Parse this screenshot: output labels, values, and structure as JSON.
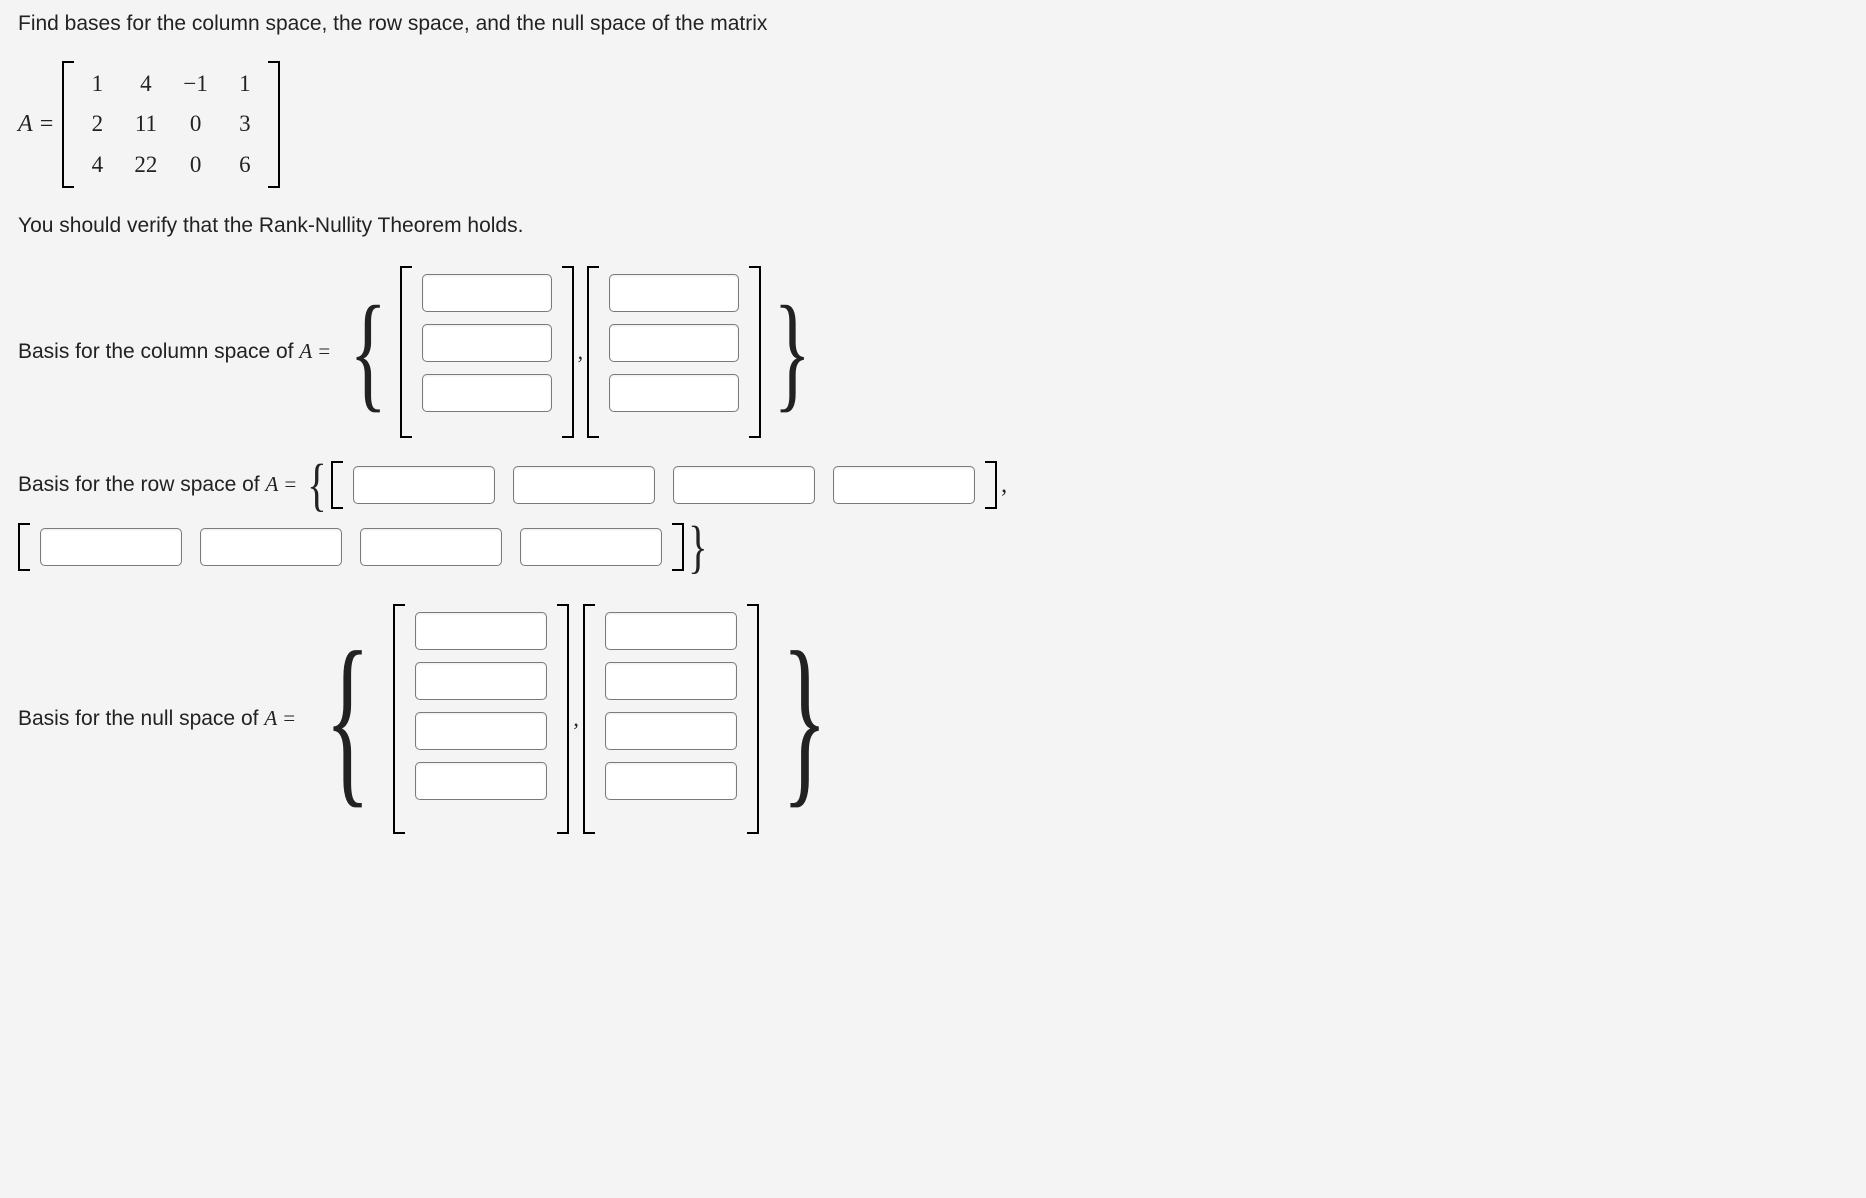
{
  "intro": "Find bases for the column space, the row space, and the null space of the matrix",
  "matrix_prefix": "A = ",
  "matrix": {
    "r1c1": "1",
    "r1c2": "4",
    "r1c3": "−1",
    "r1c4": "1",
    "r2c1": "2",
    "r2c2": "11",
    "r2c3": "0",
    "r2c4": "3",
    "r3c1": "4",
    "r3c2": "22",
    "r3c3": "0",
    "r3c4": "6"
  },
  "verify": "You should verify that the Rank-Nullity Theorem holds.",
  "labels": {
    "colspace": "Basis for the column space of ",
    "rowspace": "Basis for the row space of ",
    "nullspace": "Basis for the null space of ",
    "A_equals": "A ="
  },
  "symbols": {
    "lbrace": "{",
    "rbrace": "}",
    "comma": ",",
    "period_comma": ","
  },
  "colspace": {
    "vec1": {
      "a": "",
      "b": "",
      "c": ""
    },
    "vec2": {
      "a": "",
      "b": "",
      "c": ""
    }
  },
  "rowspace": {
    "vec1": {
      "a": "",
      "b": "",
      "c": "",
      "d": ""
    },
    "vec2": {
      "a": "",
      "b": "",
      "c": "",
      "d": ""
    }
  },
  "nullspace": {
    "vec1": {
      "a": "",
      "b": "",
      "c": "",
      "d": ""
    },
    "vec2": {
      "a": "",
      "b": "",
      "c": "",
      "d": ""
    }
  }
}
